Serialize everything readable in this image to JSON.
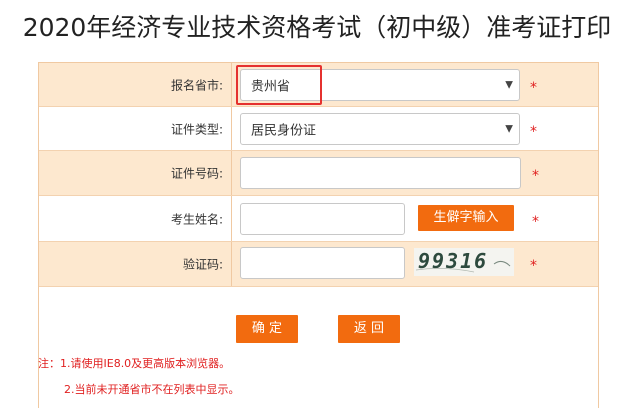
{
  "page": {
    "title": "2020年经济专业技术资格考试（初中级）准考证打印"
  },
  "form": {
    "province": {
      "label": "报名省市:",
      "value": "贵州省",
      "required_mark": "*"
    },
    "id_type": {
      "label": "证件类型:",
      "value": "居民身份证",
      "required_mark": "*"
    },
    "id_number": {
      "label": "证件号码:",
      "value": "",
      "required_mark": "*"
    },
    "name": {
      "label": "考生姓名:",
      "value": "",
      "required_mark": "*",
      "rare_char_button": "生僻字输入"
    },
    "captcha": {
      "label": "验证码:",
      "value": "",
      "image_text": "99316",
      "required_mark": "*"
    }
  },
  "actions": {
    "confirm_label": "确  定",
    "back_label": "返 回"
  },
  "notes": {
    "line1": "注：1.请使用IE8.0及更高版本浏览器。",
    "line2": "2.当前未开通省市不在列表中显示。"
  },
  "colors": {
    "accent": "#f26b0f",
    "row_alt": "#fde8cf",
    "border": "#f0c9a2",
    "required": "#e02020",
    "highlight": "#e5312f"
  }
}
